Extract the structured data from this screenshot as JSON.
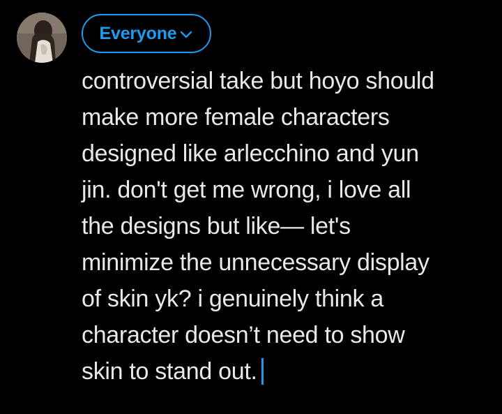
{
  "composer": {
    "audience": {
      "label": "Everyone",
      "icon": "chevron-down-icon"
    },
    "avatar": {
      "icon": "user-avatar"
    },
    "text": "controversial take but hoyo should\nmake more female characters\ndesigned like arlecchino and yun\njin. don't get me wrong, i love all\nthe designs but like— let's\nminimize the unnecessary display\nof skin yk? i genuinely think a\ncharacter doesn’t need to show\nskin to stand out."
  },
  "colors": {
    "background": "#000000",
    "text": "#e7e9ea",
    "accent": "#1d9bf0"
  }
}
